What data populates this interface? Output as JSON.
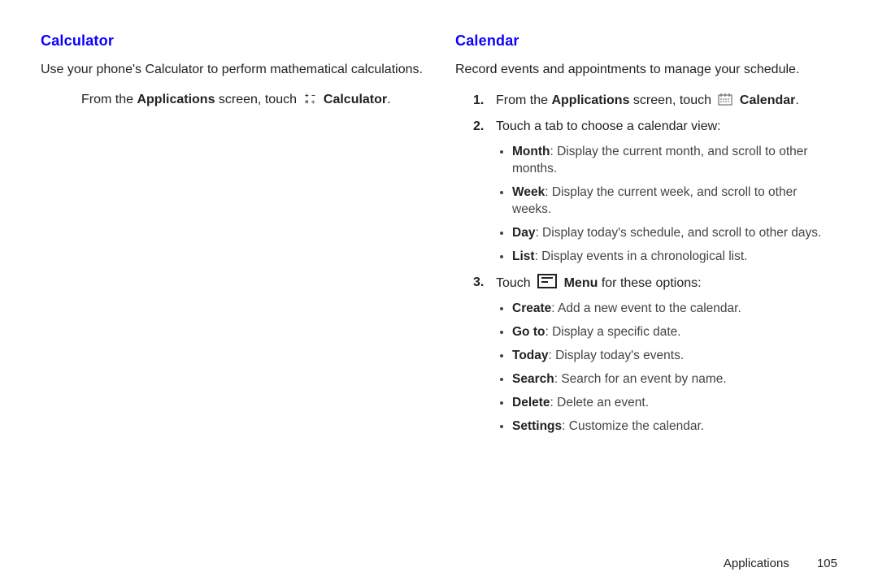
{
  "left": {
    "heading": "Calculator",
    "intro": "Use your phone's Calculator to perform mathematical calculations.",
    "step_prefix": "From the ",
    "step_applications": "Applications",
    "step_mid": " screen, touch ",
    "step_appname": "Calculator",
    "period": "."
  },
  "right": {
    "heading": "Calendar",
    "intro": "Record events and appointments to manage your schedule.",
    "step1": {
      "num": "1.",
      "prefix": "From the ",
      "applications": "Applications",
      "mid": " screen, touch ",
      "appname": "Calendar",
      "period": "."
    },
    "step2": {
      "num": "2.",
      "text": "Touch a tab to choose a calendar view:",
      "items": [
        {
          "label": "Month",
          "desc": ": Display the current month, and scroll to other months."
        },
        {
          "label": "Week",
          "desc": ": Display the current week, and scroll to other weeks."
        },
        {
          "label": "Day",
          "desc": ": Display today's schedule, and scroll to other days."
        },
        {
          "label": "List",
          "desc": ": Display events in a chronological list."
        }
      ]
    },
    "step3": {
      "num": "3.",
      "prefix": "Touch ",
      "menu": "Menu",
      "suffix": " for these options:",
      "items": [
        {
          "label": "Create",
          "desc": ": Add a new event to the calendar."
        },
        {
          "label": "Go to",
          "desc": ": Display a specific date."
        },
        {
          "label": "Today",
          "desc": ": Display today's events."
        },
        {
          "label": "Search",
          "desc": ": Search for an event by name."
        },
        {
          "label": "Delete",
          "desc": ": Delete an event."
        },
        {
          "label": "Settings",
          "desc": ": Customize the calendar."
        }
      ]
    }
  },
  "footer": {
    "section": "Applications",
    "page": "105"
  }
}
